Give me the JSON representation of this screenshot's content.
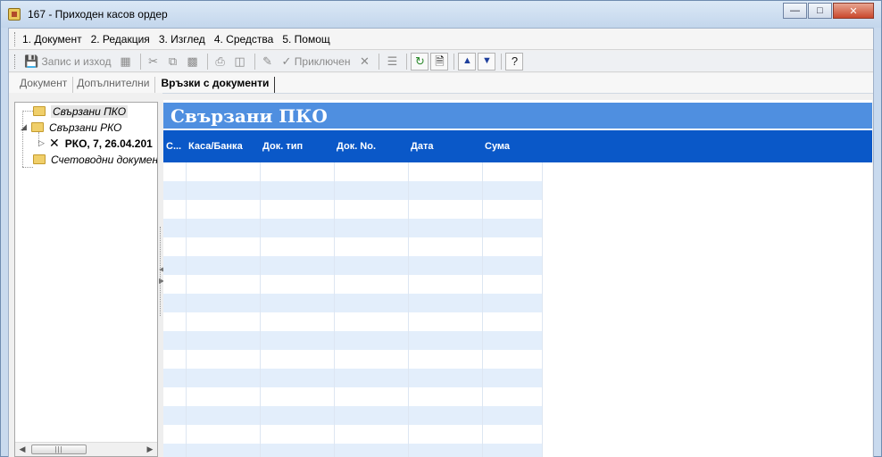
{
  "window": {
    "title": "167 - Приходен касов ордер",
    "controls": [
      "minimize",
      "maximize",
      "close"
    ]
  },
  "menu": {
    "items": [
      {
        "label": "1. Документ"
      },
      {
        "label": "2. Редакция"
      },
      {
        "label": "3. Изглед"
      },
      {
        "label": "4. Средства"
      },
      {
        "label": "5. Помощ"
      }
    ]
  },
  "toolbar": {
    "save_exit_label": "Запис и изход",
    "finished_label": "Приключен"
  },
  "tabs": [
    {
      "label": "Документ",
      "active": false
    },
    {
      "label": "Допълнителни",
      "active": false
    },
    {
      "label": "Връзки с документи",
      "active": true
    }
  ],
  "tree": {
    "nodes": [
      {
        "label": "Свързани ПКО",
        "selected": true
      },
      {
        "label": "Свързани РКО",
        "expanded": true
      },
      {
        "label": "РКО, 7, 26.04.201"
      },
      {
        "label": "Счетоводни докумен"
      }
    ]
  },
  "panel": {
    "title": "Свързани ПКО",
    "columns": [
      "С...",
      "Каса/Банка",
      "Док. тип",
      "Док. No.",
      "Дата",
      "Сума"
    ],
    "rows": []
  },
  "colors": {
    "panel_title_bg": "#4f8fe0",
    "grid_header_bg": "#0a58c8",
    "row_alt_bg": "#e3eefb"
  }
}
